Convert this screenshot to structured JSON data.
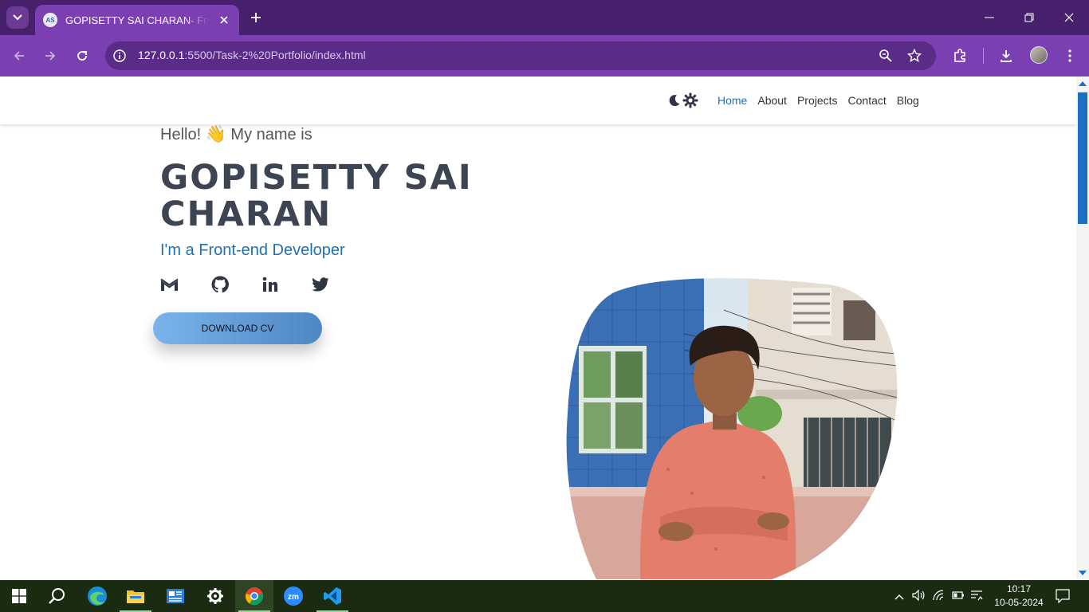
{
  "browser": {
    "tab_title": "GOPISETTY SAI CHARAN- Front-end Developer",
    "favicon_text": "AS",
    "url_host": "127.0.0.1",
    "url_rest": ":5500/Task-2%20Portfolio/index.html",
    "icons": [
      "tab-search-icon",
      "close-icon",
      "plus-icon",
      "minimize-icon",
      "restore-icon",
      "back-icon",
      "forward-icon",
      "reload-icon",
      "site-info-icon",
      "zoom-icon",
      "star-icon",
      "extensions-icon",
      "download-icon",
      "menu-icon"
    ],
    "colors": {
      "tabstrip": "#47206b",
      "toolbar": "#7a3fb0",
      "omnibox": "#5a2c87"
    }
  },
  "site": {
    "nav": {
      "links": [
        {
          "label": "Home",
          "active": true
        },
        {
          "label": "About"
        },
        {
          "label": "Projects"
        },
        {
          "label": "Contact"
        },
        {
          "label": "Blog"
        }
      ],
      "theme_icons": [
        "moon-icon",
        "sun-icon"
      ]
    },
    "hero": {
      "greeting": "Hello!",
      "wave_emoji": "👋",
      "greeting_after": "My name is",
      "name": "GOPISETTY SAI CHARAN",
      "role": "I'm a Front-end Developer",
      "cv_label": "DOWNLOAD CV",
      "socials": [
        "gmail-icon",
        "github-icon",
        "linkedin-icon",
        "twitter-icon"
      ]
    },
    "colors": {
      "accent": "#1f6fb3",
      "name": "#3d4552",
      "cv_from": "#79b4ec",
      "cv_to": "#4e86c2"
    }
  },
  "taskbar": {
    "apps": [
      "start-icon",
      "search-icon",
      "edge-icon",
      "file-explorer-icon",
      "news-icon",
      "settings-icon",
      "chrome-icon",
      "zoom-app-icon",
      "vscode-icon"
    ],
    "zoom_label": "zm",
    "time": "10:17",
    "date": "10-05-2024"
  }
}
